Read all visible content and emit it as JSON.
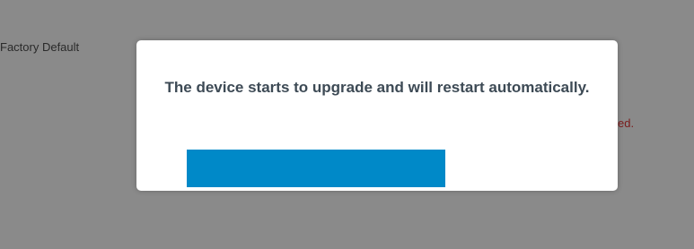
{
  "background": {
    "left_label": "Factory Default",
    "right_label": "ed."
  },
  "dialog": {
    "message": "The device starts to upgrade and will restart automatically.",
    "progress": 0.68,
    "progress_color": "#0089c8"
  },
  "colors": {
    "overlay": "#8a8a8a",
    "dialog_background": "#ffffff",
    "message_text": "#3d4a55",
    "error_text": "#7a1c1c"
  }
}
